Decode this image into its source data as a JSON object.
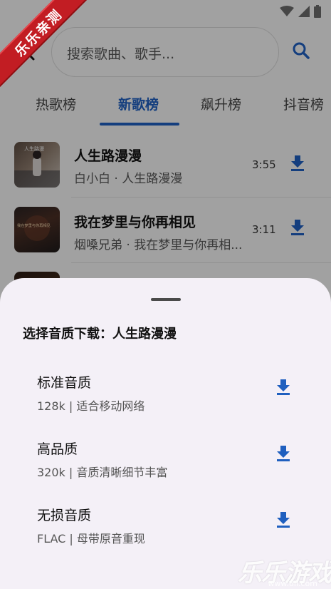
{
  "colors": {
    "accent": "#1f5fbf",
    "ribbon": "#c21d23",
    "sheet_bg": "#f4f0f7"
  },
  "ribbon": {
    "text": "乐乐亲测"
  },
  "search": {
    "placeholder": "搜索歌曲、歌手..."
  },
  "tabs": [
    {
      "label": "热歌榜"
    },
    {
      "label": "新歌榜",
      "active": true
    },
    {
      "label": "飙升榜"
    },
    {
      "label": "抖音榜"
    }
  ],
  "songs": [
    {
      "title": "人生路漫漫",
      "subtitle": "白小白 · 人生路漫漫",
      "duration": "3:55",
      "cover_caption": "人生路漫"
    },
    {
      "title": "我在梦里与你再相见",
      "subtitle": "烟嗓兄弟 · 我在梦里与你再相...",
      "duration": "3:11",
      "cover_caption": "我在梦里与你再相见"
    }
  ],
  "sheet": {
    "title": "选择音质下载：人生路漫漫",
    "options": [
      {
        "name": "标准音质",
        "desc": "128k | 适合移动网络"
      },
      {
        "name": "高品质",
        "desc": "320k | 音质清晰细节丰富"
      },
      {
        "name": "无损音质",
        "desc": "FLAC | 母带原音重现"
      }
    ]
  },
  "watermark": {
    "text": "乐乐游戏",
    "url": "www.6ll.com"
  },
  "icons": {
    "back": "chevron-left-icon",
    "search": "search-icon",
    "download": "download-icon",
    "wifi": "wifi-icon",
    "signal": "signal-icon",
    "battery": "battery-icon"
  }
}
